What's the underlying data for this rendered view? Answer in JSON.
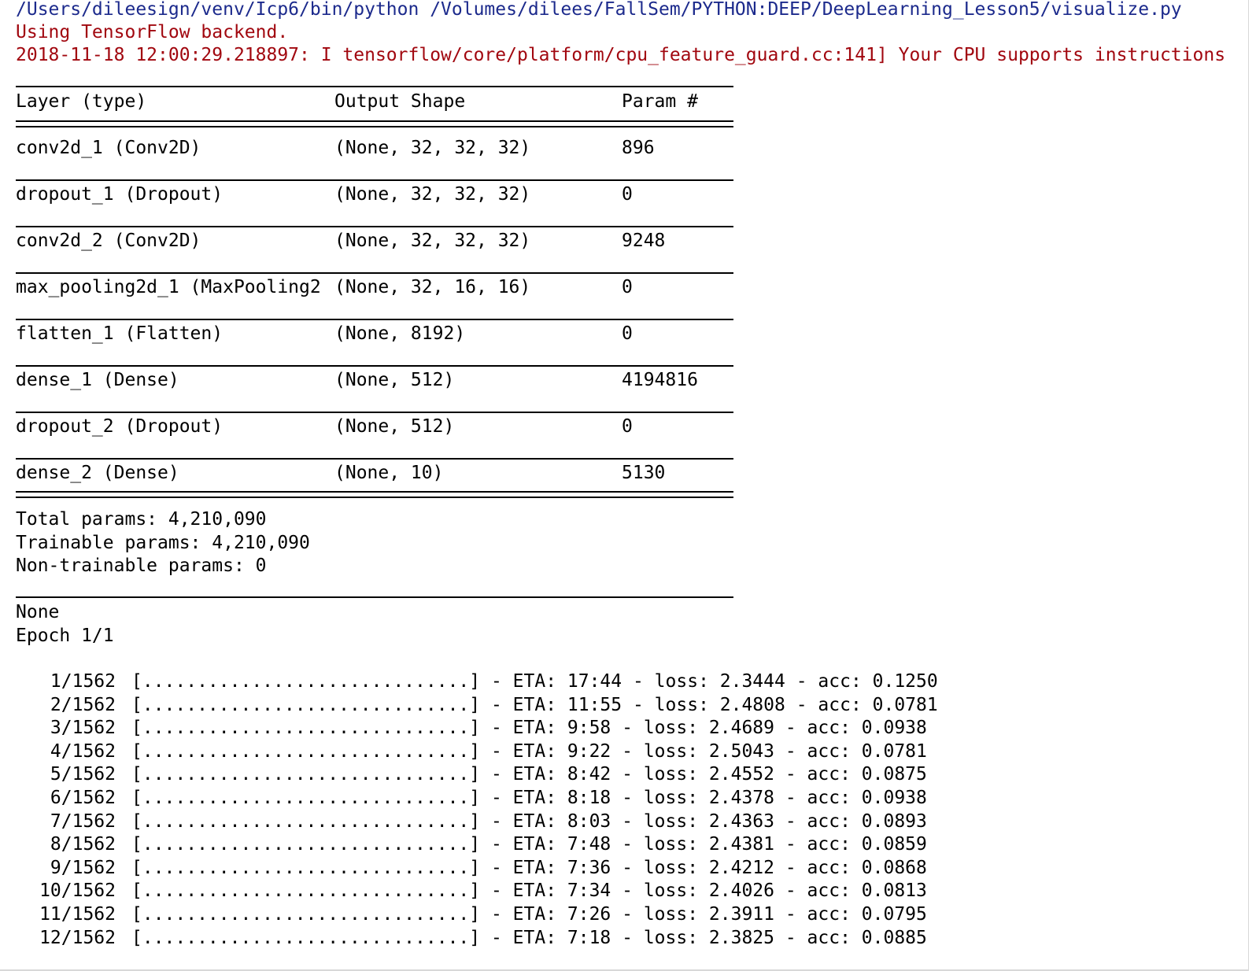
{
  "console": {
    "command": "/Users/dileesign/venv/Icp6/bin/python /Volumes/dilees/FallSem/PYTHON:DEEP/DeepLearning_Lesson5/visualize.py",
    "backend_message": "Using TensorFlow backend.",
    "cpu_warning": "2018-11-18 12:00:29.218897: I tensorflow/core/platform/cpu_feature_guard.cc:141] Your CPU supports instructions",
    "summary": {
      "headers": [
        "Layer (type)",
        "Output Shape",
        "Param #"
      ],
      "rows": [
        {
          "layer": "conv2d_1 (Conv2D)",
          "shape": "(None, 32, 32, 32)",
          "params": "896"
        },
        {
          "layer": "dropout_1 (Dropout)",
          "shape": "(None, 32, 32, 32)",
          "params": "0"
        },
        {
          "layer": "conv2d_2 (Conv2D)",
          "shape": "(None, 32, 32, 32)",
          "params": "9248"
        },
        {
          "layer": "max_pooling2d_1 (MaxPooling2",
          "shape": "(None, 32, 16, 16)",
          "params": "0"
        },
        {
          "layer": "flatten_1 (Flatten)",
          "shape": "(None, 8192)",
          "params": "0"
        },
        {
          "layer": "dense_1 (Dense)",
          "shape": "(None, 512)",
          "params": "4194816"
        },
        {
          "layer": "dropout_2 (Dropout)",
          "shape": "(None, 512)",
          "params": "0"
        },
        {
          "layer": "dense_2 (Dense)",
          "shape": "(None, 10)",
          "params": "5130"
        }
      ],
      "total_params": "Total params: 4,210,090",
      "trainable_params": "Trainable params: 4,210,090",
      "non_trainable_params": "Non-trainable params: 0"
    },
    "none_output": "None",
    "epoch": "Epoch 1/1",
    "progress": [
      {
        "step": "1/1562",
        "bar": "[..............................]",
        "eta": "17:44",
        "loss": "2.3444",
        "acc": "0.1250"
      },
      {
        "step": "2/1562",
        "bar": "[..............................]",
        "eta": "11:55",
        "loss": "2.4808",
        "acc": "0.0781"
      },
      {
        "step": "3/1562",
        "bar": "[..............................]",
        "eta": "9:58",
        "loss": "2.4689",
        "acc": "0.0938"
      },
      {
        "step": "4/1562",
        "bar": "[..............................]",
        "eta": "9:22",
        "loss": "2.5043",
        "acc": "0.0781"
      },
      {
        "step": "5/1562",
        "bar": "[..............................]",
        "eta": "8:42",
        "loss": "2.4552",
        "acc": "0.0875"
      },
      {
        "step": "6/1562",
        "bar": "[..............................]",
        "eta": "8:18",
        "loss": "2.4378",
        "acc": "0.0938"
      },
      {
        "step": "7/1562",
        "bar": "[..............................]",
        "eta": "8:03",
        "loss": "2.4363",
        "acc": "0.0893"
      },
      {
        "step": "8/1562",
        "bar": "[..............................]",
        "eta": "7:48",
        "loss": "2.4381",
        "acc": "0.0859"
      },
      {
        "step": "9/1562",
        "bar": "[..............................]",
        "eta": "7:36",
        "loss": "2.4212",
        "acc": "0.0868"
      },
      {
        "step": "10/1562",
        "bar": "[..............................]",
        "eta": "7:34",
        "loss": "2.4026",
        "acc": "0.0813"
      },
      {
        "step": "11/1562",
        "bar": "[..............................]",
        "eta": "7:26",
        "loss": "2.3911",
        "acc": "0.0795"
      },
      {
        "step": "12/1562",
        "bar": "[..............................]",
        "eta": "7:18",
        "loss": "2.3825",
        "acc": "0.0885"
      }
    ]
  }
}
